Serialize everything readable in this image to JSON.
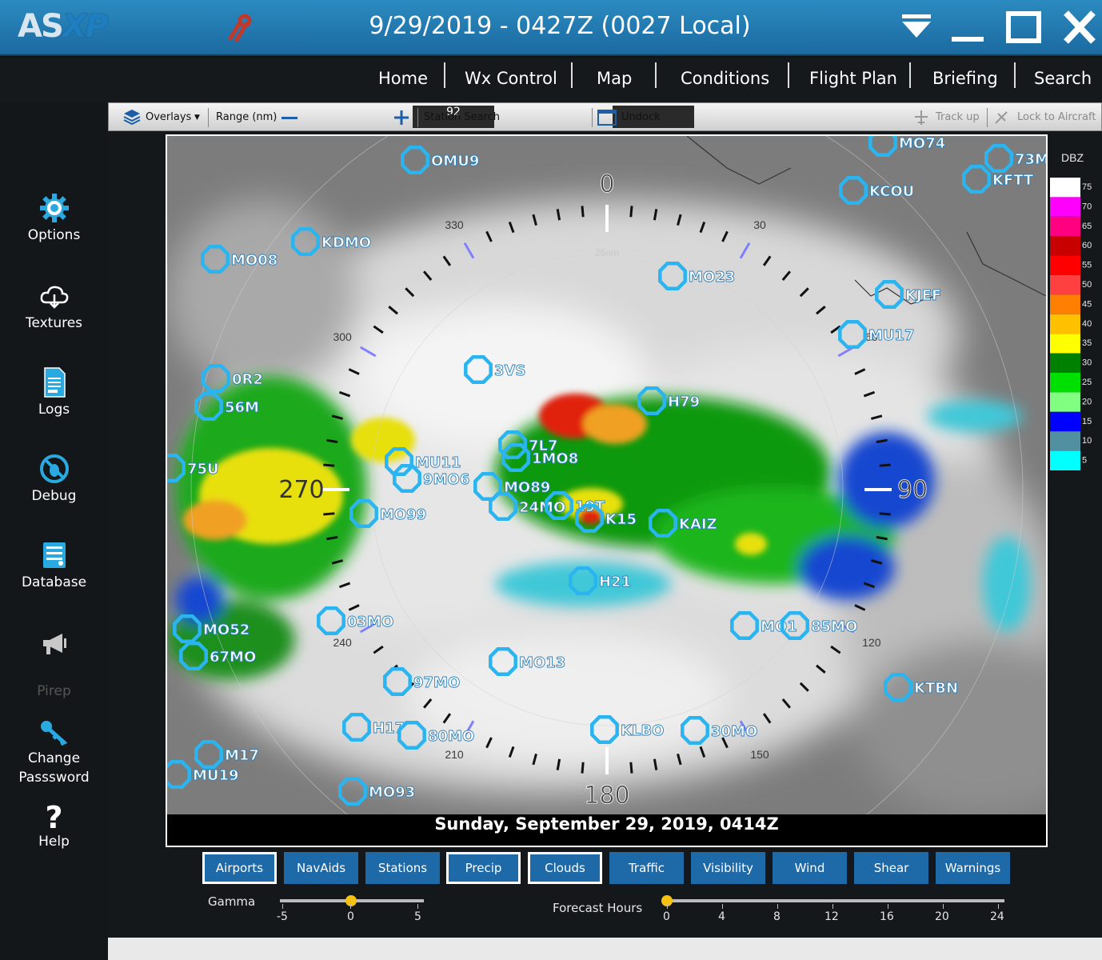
{
  "titlebar": {
    "logo_a": "AS",
    "logo_b": "XP",
    "title": "9/29/2019 - 0427Z (0027 Local)"
  },
  "nav": [
    "Home",
    "Wx Control",
    "Map",
    "Conditions",
    "Flight Plan",
    "Briefing",
    "Search"
  ],
  "sidebar": [
    "Options",
    "Textures",
    "Logs",
    "Debug",
    "Database",
    "Pirep",
    "Change",
    "Passsword",
    "Help"
  ],
  "toolbar": {
    "overlays": "Overlays",
    "range_label": "Range (nm)",
    "range_value": "92",
    "station_search": "Station Search",
    "undock": "Undock",
    "track_up": "Track up",
    "lock": "Lock to Aircraft"
  },
  "map": {
    "timestamp": "Sunday, September 29, 2019, 0414Z",
    "ring_label": "25nm",
    "headings": {
      "n": "0",
      "e": "90",
      "s": "180",
      "w": "270"
    },
    "bearing_labels": [
      "330",
      "30",
      "300",
      "60",
      "240",
      "120",
      "210",
      "150"
    ],
    "stations": [
      "OMU9",
      "MO74",
      "73M",
      "KFTT",
      "KCOU",
      "KDMO",
      "MO08",
      "MO23",
      "KJEF",
      "MU17",
      "3VS",
      "H79",
      "0R2",
      "56M",
      "7L7",
      "1MO8",
      "75U",
      "MU11",
      "9MO6",
      "MO89",
      "24MO",
      "19T",
      "K15",
      "KAIZ",
      "MO99",
      "H21",
      "MO52",
      "67MO",
      "03MO",
      "MO1",
      "85MO",
      "MO13",
      "97MO",
      "KTBN",
      "H17",
      "80MO",
      "KLBO",
      "30MO",
      "M17",
      "MU19",
      "MO93"
    ]
  },
  "legend": {
    "title": "DBZ",
    "levels": [
      "75",
      "70",
      "65",
      "60",
      "55",
      "50",
      "45",
      "40",
      "35",
      "30",
      "25",
      "20",
      "15",
      "10",
      "5"
    ],
    "colors": [
      "#ffffff",
      "#ff00ff",
      "#ff0080",
      "#c80000",
      "#ff0000",
      "#ff4040",
      "#ff8000",
      "#ffc000",
      "#ffff00",
      "#008000",
      "#00e000",
      "#80ff80",
      "#0000ff",
      "#5090a0",
      "#00ffff"
    ]
  },
  "layers": [
    "Airports",
    "NavAids",
    "Stations",
    "Precip",
    "Clouds",
    "Traffic",
    "Visibility",
    "Wind",
    "Shear",
    "Warnings"
  ],
  "layers_selected": [
    "Airports",
    "Precip",
    "Clouds"
  ],
  "gamma": {
    "label": "Gamma",
    "ticks": [
      "-5",
      "0",
      "5"
    ],
    "value": 0
  },
  "forecast": {
    "label": "Forecast Hours",
    "ticks": [
      "0",
      "4",
      "8",
      "12",
      "16",
      "20",
      "24"
    ],
    "value": 0
  }
}
